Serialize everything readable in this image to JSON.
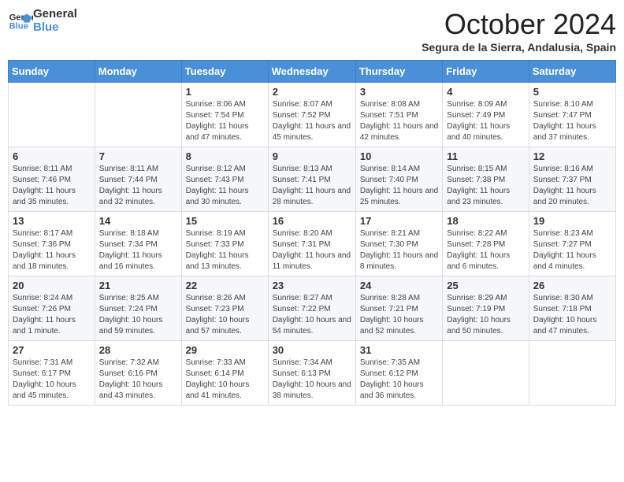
{
  "logo": {
    "line1": "General",
    "line2": "Blue"
  },
  "header": {
    "month_year": "October 2024",
    "location": "Segura de la Sierra, Andalusia, Spain"
  },
  "weekdays": [
    "Sunday",
    "Monday",
    "Tuesday",
    "Wednesday",
    "Thursday",
    "Friday",
    "Saturday"
  ],
  "weeks": [
    [
      {
        "day": "",
        "info": ""
      },
      {
        "day": "",
        "info": ""
      },
      {
        "day": "1",
        "info": "Sunrise: 8:06 AM\nSunset: 7:54 PM\nDaylight: 11 hours and 47 minutes."
      },
      {
        "day": "2",
        "info": "Sunrise: 8:07 AM\nSunset: 7:52 PM\nDaylight: 11 hours and 45 minutes."
      },
      {
        "day": "3",
        "info": "Sunrise: 8:08 AM\nSunset: 7:51 PM\nDaylight: 11 hours and 42 minutes."
      },
      {
        "day": "4",
        "info": "Sunrise: 8:09 AM\nSunset: 7:49 PM\nDaylight: 11 hours and 40 minutes."
      },
      {
        "day": "5",
        "info": "Sunrise: 8:10 AM\nSunset: 7:47 PM\nDaylight: 11 hours and 37 minutes."
      }
    ],
    [
      {
        "day": "6",
        "info": "Sunrise: 8:11 AM\nSunset: 7:46 PM\nDaylight: 11 hours and 35 minutes."
      },
      {
        "day": "7",
        "info": "Sunrise: 8:11 AM\nSunset: 7:44 PM\nDaylight: 11 hours and 32 minutes."
      },
      {
        "day": "8",
        "info": "Sunrise: 8:12 AM\nSunset: 7:43 PM\nDaylight: 11 hours and 30 minutes."
      },
      {
        "day": "9",
        "info": "Sunrise: 8:13 AM\nSunset: 7:41 PM\nDaylight: 11 hours and 28 minutes."
      },
      {
        "day": "10",
        "info": "Sunrise: 8:14 AM\nSunset: 7:40 PM\nDaylight: 11 hours and 25 minutes."
      },
      {
        "day": "11",
        "info": "Sunrise: 8:15 AM\nSunset: 7:38 PM\nDaylight: 11 hours and 23 minutes."
      },
      {
        "day": "12",
        "info": "Sunrise: 8:16 AM\nSunset: 7:37 PM\nDaylight: 11 hours and 20 minutes."
      }
    ],
    [
      {
        "day": "13",
        "info": "Sunrise: 8:17 AM\nSunset: 7:36 PM\nDaylight: 11 hours and 18 minutes."
      },
      {
        "day": "14",
        "info": "Sunrise: 8:18 AM\nSunset: 7:34 PM\nDaylight: 11 hours and 16 minutes."
      },
      {
        "day": "15",
        "info": "Sunrise: 8:19 AM\nSunset: 7:33 PM\nDaylight: 11 hours and 13 minutes."
      },
      {
        "day": "16",
        "info": "Sunrise: 8:20 AM\nSunset: 7:31 PM\nDaylight: 11 hours and 11 minutes."
      },
      {
        "day": "17",
        "info": "Sunrise: 8:21 AM\nSunset: 7:30 PM\nDaylight: 11 hours and 8 minutes."
      },
      {
        "day": "18",
        "info": "Sunrise: 8:22 AM\nSunset: 7:28 PM\nDaylight: 11 hours and 6 minutes."
      },
      {
        "day": "19",
        "info": "Sunrise: 8:23 AM\nSunset: 7:27 PM\nDaylight: 11 hours and 4 minutes."
      }
    ],
    [
      {
        "day": "20",
        "info": "Sunrise: 8:24 AM\nSunset: 7:26 PM\nDaylight: 11 hours and 1 minute."
      },
      {
        "day": "21",
        "info": "Sunrise: 8:25 AM\nSunset: 7:24 PM\nDaylight: 10 hours and 59 minutes."
      },
      {
        "day": "22",
        "info": "Sunrise: 8:26 AM\nSunset: 7:23 PM\nDaylight: 10 hours and 57 minutes."
      },
      {
        "day": "23",
        "info": "Sunrise: 8:27 AM\nSunset: 7:22 PM\nDaylight: 10 hours and 54 minutes."
      },
      {
        "day": "24",
        "info": "Sunrise: 8:28 AM\nSunset: 7:21 PM\nDaylight: 10 hours and 52 minutes."
      },
      {
        "day": "25",
        "info": "Sunrise: 8:29 AM\nSunset: 7:19 PM\nDaylight: 10 hours and 50 minutes."
      },
      {
        "day": "26",
        "info": "Sunrise: 8:30 AM\nSunset: 7:18 PM\nDaylight: 10 hours and 47 minutes."
      }
    ],
    [
      {
        "day": "27",
        "info": "Sunrise: 7:31 AM\nSunset: 6:17 PM\nDaylight: 10 hours and 45 minutes."
      },
      {
        "day": "28",
        "info": "Sunrise: 7:32 AM\nSunset: 6:16 PM\nDaylight: 10 hours and 43 minutes."
      },
      {
        "day": "29",
        "info": "Sunrise: 7:33 AM\nSunset: 6:14 PM\nDaylight: 10 hours and 41 minutes."
      },
      {
        "day": "30",
        "info": "Sunrise: 7:34 AM\nSunset: 6:13 PM\nDaylight: 10 hours and 38 minutes."
      },
      {
        "day": "31",
        "info": "Sunrise: 7:35 AM\nSunset: 6:12 PM\nDaylight: 10 hours and 36 minutes."
      },
      {
        "day": "",
        "info": ""
      },
      {
        "day": "",
        "info": ""
      }
    ]
  ]
}
